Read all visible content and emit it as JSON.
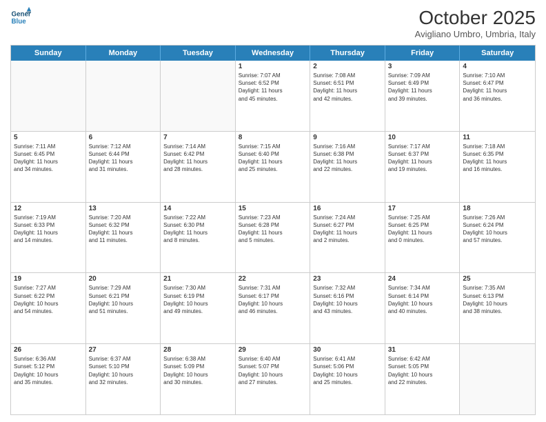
{
  "header": {
    "logo_line1": "General",
    "logo_line2": "Blue",
    "month": "October 2025",
    "location": "Avigliano Umbro, Umbria, Italy"
  },
  "days_of_week": [
    "Sunday",
    "Monday",
    "Tuesday",
    "Wednesday",
    "Thursday",
    "Friday",
    "Saturday"
  ],
  "weeks": [
    [
      {
        "day": "",
        "info": ""
      },
      {
        "day": "",
        "info": ""
      },
      {
        "day": "",
        "info": ""
      },
      {
        "day": "1",
        "info": "Sunrise: 7:07 AM\nSunset: 6:52 PM\nDaylight: 11 hours\nand 45 minutes."
      },
      {
        "day": "2",
        "info": "Sunrise: 7:08 AM\nSunset: 6:51 PM\nDaylight: 11 hours\nand 42 minutes."
      },
      {
        "day": "3",
        "info": "Sunrise: 7:09 AM\nSunset: 6:49 PM\nDaylight: 11 hours\nand 39 minutes."
      },
      {
        "day": "4",
        "info": "Sunrise: 7:10 AM\nSunset: 6:47 PM\nDaylight: 11 hours\nand 36 minutes."
      }
    ],
    [
      {
        "day": "5",
        "info": "Sunrise: 7:11 AM\nSunset: 6:45 PM\nDaylight: 11 hours\nand 34 minutes."
      },
      {
        "day": "6",
        "info": "Sunrise: 7:12 AM\nSunset: 6:44 PM\nDaylight: 11 hours\nand 31 minutes."
      },
      {
        "day": "7",
        "info": "Sunrise: 7:14 AM\nSunset: 6:42 PM\nDaylight: 11 hours\nand 28 minutes."
      },
      {
        "day": "8",
        "info": "Sunrise: 7:15 AM\nSunset: 6:40 PM\nDaylight: 11 hours\nand 25 minutes."
      },
      {
        "day": "9",
        "info": "Sunrise: 7:16 AM\nSunset: 6:38 PM\nDaylight: 11 hours\nand 22 minutes."
      },
      {
        "day": "10",
        "info": "Sunrise: 7:17 AM\nSunset: 6:37 PM\nDaylight: 11 hours\nand 19 minutes."
      },
      {
        "day": "11",
        "info": "Sunrise: 7:18 AM\nSunset: 6:35 PM\nDaylight: 11 hours\nand 16 minutes."
      }
    ],
    [
      {
        "day": "12",
        "info": "Sunrise: 7:19 AM\nSunset: 6:33 PM\nDaylight: 11 hours\nand 14 minutes."
      },
      {
        "day": "13",
        "info": "Sunrise: 7:20 AM\nSunset: 6:32 PM\nDaylight: 11 hours\nand 11 minutes."
      },
      {
        "day": "14",
        "info": "Sunrise: 7:22 AM\nSunset: 6:30 PM\nDaylight: 11 hours\nand 8 minutes."
      },
      {
        "day": "15",
        "info": "Sunrise: 7:23 AM\nSunset: 6:28 PM\nDaylight: 11 hours\nand 5 minutes."
      },
      {
        "day": "16",
        "info": "Sunrise: 7:24 AM\nSunset: 6:27 PM\nDaylight: 11 hours\nand 2 minutes."
      },
      {
        "day": "17",
        "info": "Sunrise: 7:25 AM\nSunset: 6:25 PM\nDaylight: 11 hours\nand 0 minutes."
      },
      {
        "day": "18",
        "info": "Sunrise: 7:26 AM\nSunset: 6:24 PM\nDaylight: 10 hours\nand 57 minutes."
      }
    ],
    [
      {
        "day": "19",
        "info": "Sunrise: 7:27 AM\nSunset: 6:22 PM\nDaylight: 10 hours\nand 54 minutes."
      },
      {
        "day": "20",
        "info": "Sunrise: 7:29 AM\nSunset: 6:21 PM\nDaylight: 10 hours\nand 51 minutes."
      },
      {
        "day": "21",
        "info": "Sunrise: 7:30 AM\nSunset: 6:19 PM\nDaylight: 10 hours\nand 49 minutes."
      },
      {
        "day": "22",
        "info": "Sunrise: 7:31 AM\nSunset: 6:17 PM\nDaylight: 10 hours\nand 46 minutes."
      },
      {
        "day": "23",
        "info": "Sunrise: 7:32 AM\nSunset: 6:16 PM\nDaylight: 10 hours\nand 43 minutes."
      },
      {
        "day": "24",
        "info": "Sunrise: 7:34 AM\nSunset: 6:14 PM\nDaylight: 10 hours\nand 40 minutes."
      },
      {
        "day": "25",
        "info": "Sunrise: 7:35 AM\nSunset: 6:13 PM\nDaylight: 10 hours\nand 38 minutes."
      }
    ],
    [
      {
        "day": "26",
        "info": "Sunrise: 6:36 AM\nSunset: 5:12 PM\nDaylight: 10 hours\nand 35 minutes."
      },
      {
        "day": "27",
        "info": "Sunrise: 6:37 AM\nSunset: 5:10 PM\nDaylight: 10 hours\nand 32 minutes."
      },
      {
        "day": "28",
        "info": "Sunrise: 6:38 AM\nSunset: 5:09 PM\nDaylight: 10 hours\nand 30 minutes."
      },
      {
        "day": "29",
        "info": "Sunrise: 6:40 AM\nSunset: 5:07 PM\nDaylight: 10 hours\nand 27 minutes."
      },
      {
        "day": "30",
        "info": "Sunrise: 6:41 AM\nSunset: 5:06 PM\nDaylight: 10 hours\nand 25 minutes."
      },
      {
        "day": "31",
        "info": "Sunrise: 6:42 AM\nSunset: 5:05 PM\nDaylight: 10 hours\nand 22 minutes."
      },
      {
        "day": "",
        "info": ""
      }
    ]
  ]
}
